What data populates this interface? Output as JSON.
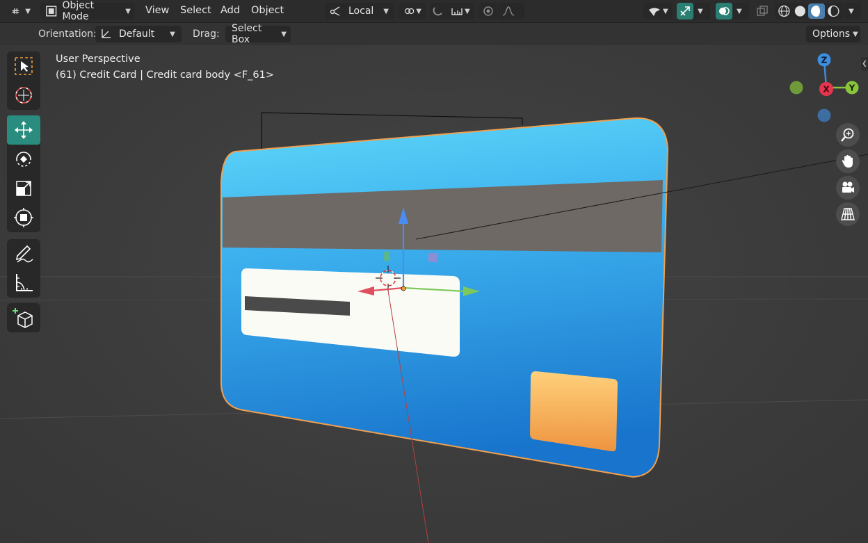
{
  "header": {
    "mode_label": "Object Mode",
    "menus": [
      "View",
      "Select",
      "Add",
      "Object"
    ],
    "transform_space": "Local"
  },
  "toolsettings": {
    "orientation_label": "Orientation:",
    "orientation_value": "Default",
    "drag_label": "Drag:",
    "drag_value": "Select Box",
    "options_label": "Options"
  },
  "viewport": {
    "view_name": "User Perspective",
    "object_info": "(61) Credit Card | Credit card body <F_61>"
  },
  "gizmo": {
    "axes": [
      "Z",
      "X",
      "Y"
    ],
    "colors": {
      "x": "#e6364e",
      "y": "#8ac53c",
      "z": "#3c8ee0",
      "neg_x": "#8a3a46",
      "neg_y": "#6f9a3a",
      "neg_z": "#3e6da1"
    }
  },
  "colors": {
    "accent": "#2a8c7e",
    "card_top": "#5bd4f7",
    "card_bottom": "#1e7fd1",
    "stripe": "#6f6966",
    "chip": "#f2a64a",
    "selection_outline": "#f0a050"
  },
  "icons": {
    "editor_type": "editor-type-icon",
    "mode": "object-mode-icon",
    "orientation": "orientation-icon"
  }
}
